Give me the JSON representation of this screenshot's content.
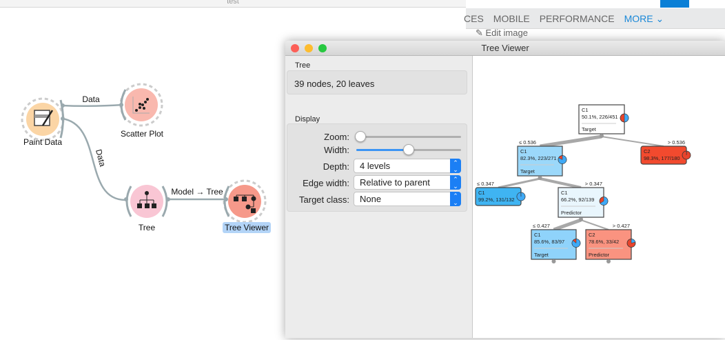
{
  "canvas": {
    "title": "test",
    "widgets": [
      {
        "name": "Paint Data"
      },
      {
        "name": "Scatter Plot"
      },
      {
        "name": "Tree"
      },
      {
        "name": "Tree Viewer"
      }
    ],
    "links": [
      {
        "label": "Data"
      },
      {
        "label": "Data"
      },
      {
        "label": "Model → Tree"
      }
    ]
  },
  "web": {
    "nav": [
      "CES",
      "MOBILE",
      "PERFORMANCE",
      "MORE ⌄"
    ],
    "edit_label": "✎ Edit image",
    "accent": "#0a7fd6"
  },
  "tree_viewer": {
    "title": "Tree Viewer",
    "tree_group": "Tree",
    "tree_info": "39 nodes, 20 leaves",
    "display_group": "Display",
    "zoom_label": "Zoom:",
    "zoom_value": 0,
    "width_label": "Width:",
    "width_value": 0.5,
    "depth_label": "Depth:",
    "depth_value": "4 levels",
    "edge_label": "Edge width:",
    "edge_value": "Relative to parent",
    "target_label": "Target class:",
    "target_value": "None",
    "nodes": [
      {
        "cls": "C1",
        "stats": "50.1%, 226/451",
        "attr": "Target",
        "color": "#ffffff",
        "p": 0.501
      },
      {
        "cls": "C1",
        "stats": "82.3%, 223/271",
        "attr": "Target",
        "color": "#9bd8fa",
        "p": 0.823,
        "edge": "≤ 0.536"
      },
      {
        "cls": "C2",
        "stats": "98.3%, 177/180",
        "attr": "",
        "color": "#f24a2e",
        "p": 0.017,
        "edge": "> 0.536"
      },
      {
        "cls": "C1",
        "stats": "99.2%, 131/132",
        "attr": "",
        "color": "#3fb4f2",
        "p": 0.992,
        "edge": "≤ 0.347"
      },
      {
        "cls": "C1",
        "stats": "66.2%, 92/139",
        "attr": "Predictor",
        "color": "#e9f6fd",
        "p": 0.662,
        "edge": "> 0.347"
      },
      {
        "cls": "C1",
        "stats": "85.6%, 83/97",
        "attr": "Target",
        "color": "#8fd3fb",
        "p": 0.856,
        "edge": "≤ 0.427"
      },
      {
        "cls": "C2",
        "stats": "78.6%, 33/42",
        "attr": "Predictor",
        "color": "#fa9380",
        "p": 0.214,
        "edge": "> 0.427"
      }
    ]
  }
}
